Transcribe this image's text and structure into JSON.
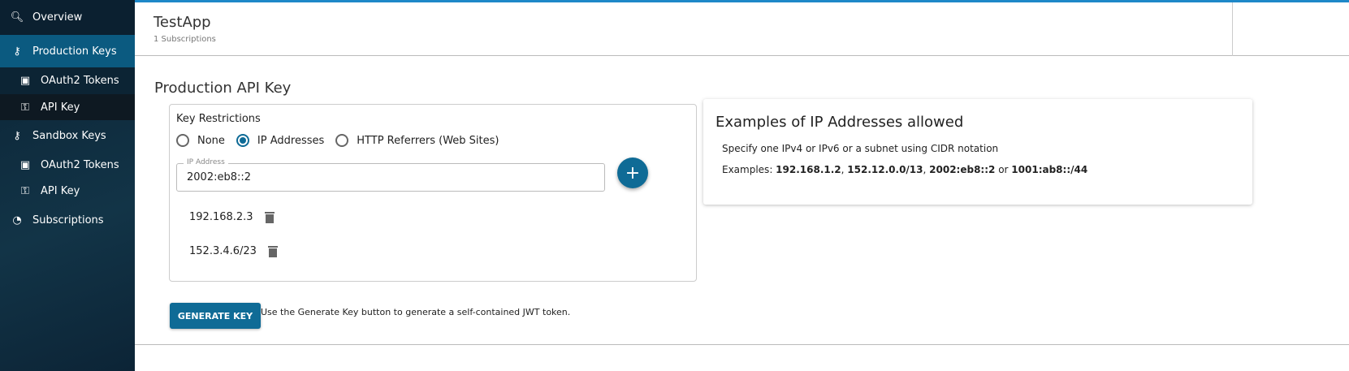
{
  "sidebar": {
    "items": [
      {
        "label": "Overview",
        "icon": "overview-search-icon"
      },
      {
        "label": "Production Keys",
        "icon": "keys-icon",
        "active": true
      },
      {
        "label": "OAuth2 Tokens",
        "icon": "lock-icon"
      },
      {
        "label": "API Key",
        "icon": "key-icon",
        "selected": true
      },
      {
        "label": "Sandbox Keys",
        "icon": "keys-icon"
      },
      {
        "label": "OAuth2 Tokens",
        "icon": "lock-icon"
      },
      {
        "label": "API Key",
        "icon": "key-icon"
      },
      {
        "label": "Subscriptions",
        "icon": "rss-icon"
      }
    ]
  },
  "header": {
    "title": "TestApp",
    "subtitle": "1 Subscriptions"
  },
  "main": {
    "title": "Production API Key",
    "restrictions": {
      "label": "Key Restrictions",
      "options": [
        "None",
        "IP Addresses",
        "HTTP Referrers (Web Sites)"
      ],
      "selected": "IP Addresses"
    },
    "ip_field": {
      "label": "IP Address",
      "value": "2002:eb8::2"
    },
    "add_label": "+",
    "ips": [
      "192.168.2.3",
      "152.3.4.6/23"
    ],
    "generate": {
      "label": "GENERATE KEY",
      "hint": "Use the Generate Key button to generate a self-contained JWT token."
    }
  },
  "examples": {
    "title": "Examples of IP Addresses allowed",
    "line1": "Specify one IPv4 or IPv6 or a subnet using CIDR notation",
    "prefix": "Examples: ",
    "items": [
      "192.168.1.2",
      "152.12.0.0/13",
      "2002:eb8::2",
      "1001:ab8::/44"
    ],
    "sep1": ", ",
    "sep2": ", ",
    "or": " or "
  },
  "colors": {
    "accent": "#0f6b96",
    "sidebar": "#0b2233",
    "topbar": "#1e88c8"
  }
}
